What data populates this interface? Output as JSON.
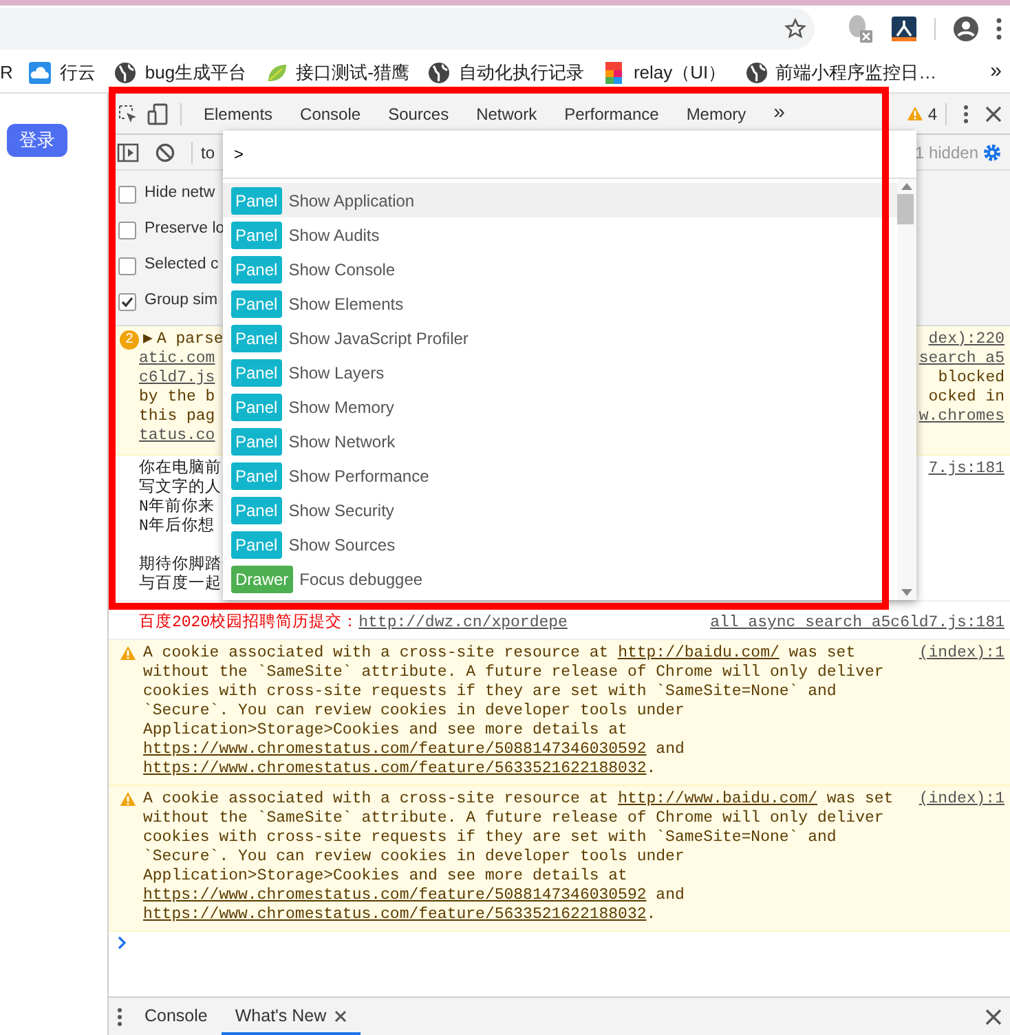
{
  "bookmarks": {
    "items": [
      {
        "label": "R"
      },
      {
        "label": "行云"
      },
      {
        "label": "bug生成平台"
      },
      {
        "label": "接口测试-猎鹰"
      },
      {
        "label": "自动化执行记录"
      },
      {
        "label": "relay（UI）"
      },
      {
        "label": "前端小程序监控日…"
      }
    ],
    "overflow": "»"
  },
  "page": {
    "login_button": "登录"
  },
  "devtools": {
    "tabs": [
      "Elements",
      "Console",
      "Sources",
      "Network",
      "Performance",
      "Memory"
    ],
    "more_tabs": "»",
    "warning_count": "4",
    "console_toolbar": {
      "context": "to",
      "hidden_count": "1 hidden"
    },
    "settings": [
      {
        "label": "Hide netw",
        "checked": false
      },
      {
        "label": "Preserve lo",
        "checked": false
      },
      {
        "label": "Selected c",
        "checked": false
      },
      {
        "label": "Group sim",
        "checked": true
      }
    ],
    "messages": [
      {
        "kind": "group",
        "count": "2",
        "expander": "▶",
        "left": [
          "A parse",
          "atic.com",
          "c6ld7.js",
          "by the b",
          "this pag",
          "tatus.co"
        ],
        "right": [
          "dex):220",
          "search a5",
          "blocked",
          "ocked in",
          "w.chromes"
        ]
      },
      {
        "kind": "log",
        "paragraphs": [
          [
            "你在电脑前",
            "写文字的人",
            "N年前你来",
            "N年后你想"
          ],
          [
            "期待你脚踏",
            "与百度一起"
          ]
        ],
        "right": [
          "7.js:181"
        ]
      },
      {
        "kind": "link",
        "text": "百度2020校园招聘简历提交：",
        "link": "http://dwz.cn/xpordepe",
        "source": "all async search a5c6ld7.js:181"
      },
      {
        "kind": "warning",
        "source": "(index):1",
        "parts": [
          {
            "text": "A cookie associated with a cross-site resource at "
          },
          {
            "text": "http://baidu.com/",
            "link": true
          },
          {
            "text": " was set without the `SameSite` attribute. A future release of Chrome will only deliver cookies with cross-site requests if they are set with `SameSite=None` and `Secure`. You can review cookies in developer tools under Application>Storage>Cookies and see more details at "
          },
          {
            "text": "https://www.chromestatus.com/feature/5088147346030592",
            "link": true
          },
          {
            "text": " and "
          },
          {
            "text": "https://www.chromestatus.com/feature/5633521622188032",
            "link": true
          },
          {
            "text": "."
          }
        ]
      },
      {
        "kind": "warning",
        "source": "(index):1",
        "parts": [
          {
            "text": "A cookie associated with a cross-site resource at "
          },
          {
            "text": "http://www.baidu.com/",
            "link": true
          },
          {
            "text": " was set without the `SameSite` attribute. A future release of Chrome will only deliver cookies with cross-site requests if they are set with `SameSite=None` and `Secure`. You can review cookies in developer tools under Application>Storage>Cookies and see more details at "
          },
          {
            "text": "https://www.chromestatus.com/feature/5088147346030592",
            "link": true
          },
          {
            "text": " and "
          },
          {
            "text": "https://www.chromestatus.com/feature/5633521622188032",
            "link": true
          },
          {
            "text": "."
          }
        ]
      }
    ],
    "command_menu": {
      "value": ">",
      "items": [
        {
          "category": "Panel",
          "color": "#12b5cb",
          "title": "Show Application",
          "selected": true
        },
        {
          "category": "Panel",
          "color": "#12b5cb",
          "title": "Show Audits",
          "selected": false
        },
        {
          "category": "Panel",
          "color": "#12b5cb",
          "title": "Show Console",
          "selected": false
        },
        {
          "category": "Panel",
          "color": "#12b5cb",
          "title": "Show Elements",
          "selected": false
        },
        {
          "category": "Panel",
          "color": "#12b5cb",
          "title": "Show JavaScript Profiler",
          "selected": false
        },
        {
          "category": "Panel",
          "color": "#12b5cb",
          "title": "Show Layers",
          "selected": false
        },
        {
          "category": "Panel",
          "color": "#12b5cb",
          "title": "Show Memory",
          "selected": false
        },
        {
          "category": "Panel",
          "color": "#12b5cb",
          "title": "Show Network",
          "selected": false
        },
        {
          "category": "Panel",
          "color": "#12b5cb",
          "title": "Show Performance",
          "selected": false
        },
        {
          "category": "Panel",
          "color": "#12b5cb",
          "title": "Show Security",
          "selected": false
        },
        {
          "category": "Panel",
          "color": "#12b5cb",
          "title": "Show Sources",
          "selected": false
        },
        {
          "category": "Drawer",
          "color": "#4caf50",
          "title": "Focus debuggee",
          "selected": false
        }
      ]
    },
    "drawer_tabs": [
      {
        "label": "Console",
        "selected": false,
        "closable": false
      },
      {
        "label": "What's New",
        "selected": true,
        "closable": true
      }
    ]
  }
}
